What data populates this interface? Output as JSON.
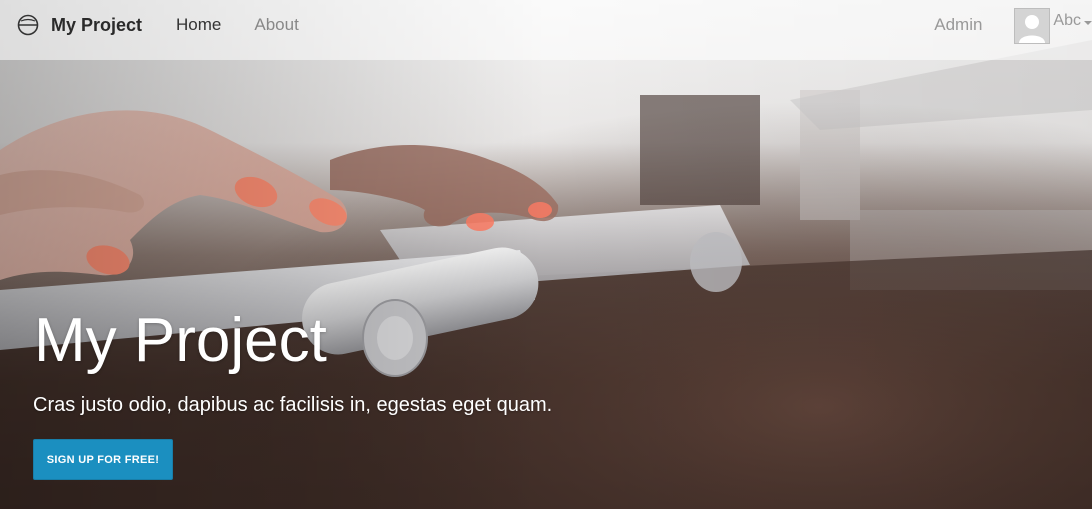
{
  "navbar": {
    "brand_icon": "globe-icon",
    "brand_name": "My Project",
    "links": [
      {
        "label": "Home",
        "active": true
      },
      {
        "label": "About",
        "active": false
      }
    ],
    "admin_label": "Admin",
    "user": {
      "avatar_icon": "user-avatar-icon",
      "name": "Abc",
      "menu_icon": "caret-down-icon"
    }
  },
  "hero": {
    "background": "photo of hands typing on a white keyboard on a dark wooden desk",
    "title": "My Project",
    "subtitle": "Cras justo odio, dapibus ac facilisis in, egestas eget quam.",
    "cta_label": "SIGN UP FOR FREE!"
  },
  "colors": {
    "brand_text": "#2a2a2a",
    "nav_active": "#333333",
    "nav_muted": "#888888",
    "cta_background": "#1b8fc0",
    "hero_text": "#ffffff"
  }
}
